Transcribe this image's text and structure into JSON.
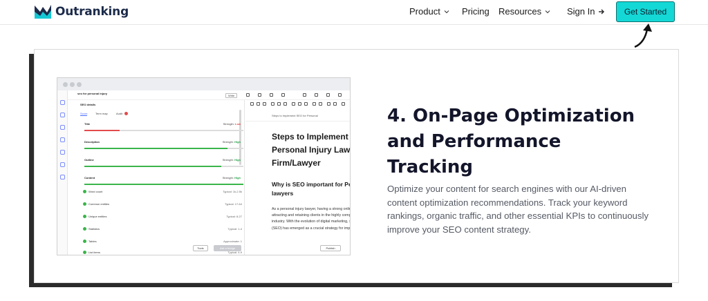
{
  "brand": {
    "name": "Outranking"
  },
  "nav": {
    "product": "Product",
    "pricing": "Pricing",
    "resources": "Resources",
    "sign_in": "Sign In",
    "get_started": "Get Started"
  },
  "feature": {
    "title": "4. On-Page Optimization and Performance Tracking",
    "description": "Optimize your content for search engines with our AI-driven content optimization recommendations. Track your keyword rankings, organic traffic, and other essential KPIs to continuously improve your SEO content strategy."
  },
  "mock": {
    "doc_title": "seo for personal injury",
    "panel_title": "SEO details",
    "tabs": [
      "Score",
      "Term map",
      "Audit"
    ],
    "sections": [
      {
        "label": "Title",
        "status_prefix": "Strength:",
        "status": "Low",
        "fill": 0.22
      },
      {
        "label": "Description",
        "status_prefix": "Strength:",
        "status": "High",
        "fill": 0.9
      },
      {
        "label": "Outline",
        "status_prefix": "Strength:",
        "status": "High",
        "fill": 0.86
      },
      {
        "label": "Content",
        "status_prefix": "Strength:",
        "status": "High",
        "fill": 1.0
      }
    ],
    "content_items": [
      {
        "label": "Word count",
        "value": "Typical: 1k-2.5k"
      },
      {
        "label": "Common entities",
        "value": "Typical: 17-64"
      },
      {
        "label": "Unique entities",
        "value": "Typical: 8-27"
      },
      {
        "label": "Statistics",
        "value": "Typical: 1-4"
      },
      {
        "label": "Tables",
        "value": "Approximate: 1"
      },
      {
        "label": "List items",
        "value": "Typical: 4-9"
      }
    ],
    "breadcrumb": "Steps to Implement SEO for Personal",
    "h1": "Steps to Implement SEO for Personal Injury Law Firm/Lawyer",
    "h2": "Why is SEO important for Personal injury lawyers",
    "paragraph": "As a personal injury lawyer, having a strong online presence is crucial in attracting and retaining clients in the highly competitive and saturated legal industry. With the evolution of digital marketing, search engine optimization (SEO) has emerged as a crucial strategy for improving online visibility and",
    "mode_label": "Write",
    "tools_label": "Tools",
    "ask_label": "Ask a bridge",
    "publish_label": "Publish"
  },
  "colors": {
    "accent": "#14d8d6",
    "navy": "#13152a",
    "good": "#39b54a",
    "low": "#e24b4b"
  }
}
